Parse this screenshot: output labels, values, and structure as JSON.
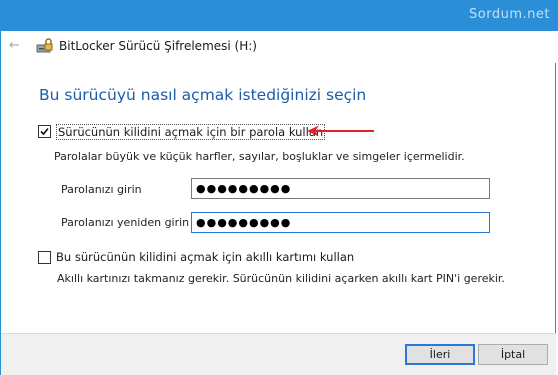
{
  "window": {
    "title": "BitLocker Sürücü Şifrelemesi (H:)",
    "watermark": "Sordum.net",
    "accent_color": "#2b8fd8"
  },
  "nav": {
    "back_icon": "back-arrow-icon"
  },
  "main": {
    "heading": "Bu sürücüyü nasıl açmak istediğinizi seçin",
    "heading_color": "#1c5ca8",
    "password_option": {
      "label": "Sürücünün kilidini açmak için bir parola kullan",
      "checked": true,
      "description": "Parolalar büyük ve küçük harfler, sayılar, boşluklar ve simgeler içermelidir.",
      "enter_label": "Parolanızı girin",
      "enter_value": "●●●●●●●●●",
      "reenter_label": "Parolanızı yeniden girin",
      "reenter_value": "●●●●●●●●●"
    },
    "smartcard_option": {
      "label": "Bu sürücünün kilidini açmak için akıllı kartımı kullan",
      "checked": false,
      "description": "Akıllı kartınızı takmanız gerekir. Sürücünün kilidini açarken akıllı kart PIN'i gerekir."
    },
    "annotation_arrow_color": "#e0202a"
  },
  "footer": {
    "next_label": "İleri",
    "cancel_label": "İptal"
  }
}
